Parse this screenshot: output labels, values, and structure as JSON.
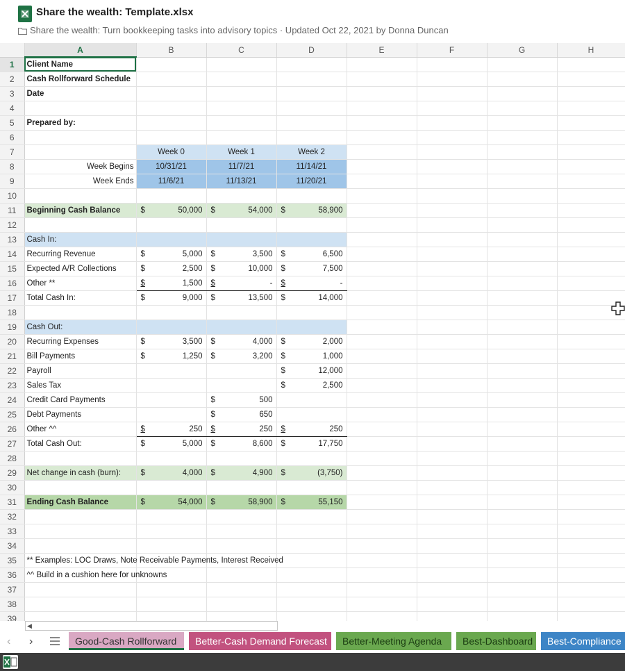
{
  "app": {
    "title": "Share the wealth: Template.xlsx",
    "subtitle": "Share the wealth: Turn bookkeeping tasks into advisory topics · Updated Oct 22, 2021 by Donna Duncan",
    "icons": {
      "file": "excel-icon",
      "folder": "folder-icon"
    }
  },
  "columns": [
    "A",
    "B",
    "C",
    "D",
    "E",
    "F",
    "G",
    "H"
  ],
  "rows": {
    "r1": {
      "a": "Client Name"
    },
    "r2": {
      "a": "Cash Rollforward Schedule"
    },
    "r3": {
      "a": "Date"
    },
    "r5": {
      "a": "Prepared by:"
    },
    "r7": {
      "b": "Week 0",
      "c": "Week 1",
      "d": "Week 2"
    },
    "r8": {
      "a": "Week Begins",
      "b": "10/31/21",
      "c": "11/7/21",
      "d": "11/14/21"
    },
    "r9": {
      "a": "Week Ends",
      "b": "11/6/21",
      "c": "11/13/21",
      "d": "11/20/21"
    },
    "r11": {
      "a": "Beginning Cash Balance",
      "b": "50,000",
      "c": "54,000",
      "d": "58,900"
    },
    "r13": {
      "a": "Cash In:"
    },
    "r14": {
      "a": "Recurring Revenue",
      "b": "5,000",
      "c": "3,500",
      "d": "6,500"
    },
    "r15": {
      "a": "Expected A/R Collections",
      "b": "2,500",
      "c": "10,000",
      "d": "7,500"
    },
    "r16": {
      "a": "Other **",
      "b": "1,500",
      "c": "-",
      "d": "-"
    },
    "r17": {
      "a": "Total Cash In:",
      "b": "9,000",
      "c": "13,500",
      "d": "14,000"
    },
    "r19": {
      "a": "Cash Out:"
    },
    "r20": {
      "a": "Recurring Expenses",
      "b": "3,500",
      "c": "4,000",
      "d": "2,000"
    },
    "r21": {
      "a": "Bill Payments",
      "b": "1,250",
      "c": "3,200",
      "d": "1,000"
    },
    "r22": {
      "a": "Payroll",
      "d": "12,000"
    },
    "r23": {
      "a": "Sales Tax",
      "d": "2,500"
    },
    "r24": {
      "a": "Credit Card Payments",
      "c": "500"
    },
    "r25": {
      "a": "Debt Payments",
      "c": "650"
    },
    "r26": {
      "a": "Other ^^",
      "b": "250",
      "c": "250",
      "d": "250"
    },
    "r27": {
      "a": "Total Cash Out:",
      "b": "5,000",
      "c": "8,600",
      "d": "17,750"
    },
    "r29": {
      "a": "Net change in cash (burn):",
      "b": "4,000",
      "c": "4,900",
      "d": "(3,750)"
    },
    "r31": {
      "a": "Ending Cash Balance",
      "b": "54,000",
      "c": "58,900",
      "d": "55,150"
    },
    "r35": {
      "a": "** Examples: LOC Draws, Note Receivable Payments, Interest Received"
    },
    "r36": {
      "a": "^^ Build in a cushion here for unknowns"
    }
  },
  "currency_symbol": "$",
  "sheet_tabs": [
    {
      "label": "Good-Cash Rollforward",
      "active": true,
      "color": "#d9a8c3"
    },
    {
      "label": "Better-Cash Demand Forecast",
      "color": "#c2527f"
    },
    {
      "label": "Better-Meeting Agenda",
      "color": "#6aa84f"
    },
    {
      "label": "Best-Dashboard",
      "color": "#6aa84f"
    },
    {
      "label": "Best-Compliance",
      "color": "#3d85c6"
    }
  ],
  "colors": {
    "accent": "#1e7145",
    "light_green": "#d9ead3",
    "green": "#b6d7a8",
    "light_blue": "#cfe2f3",
    "blue": "#9fc5e8"
  }
}
